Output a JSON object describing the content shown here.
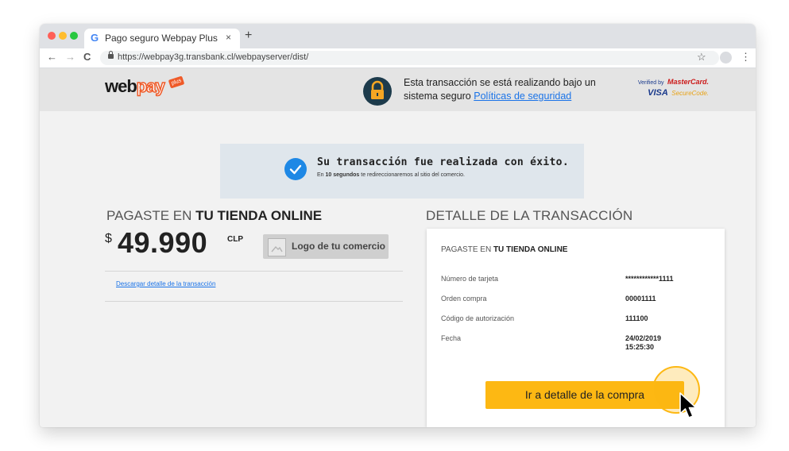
{
  "browser": {
    "tab_favicon": "G",
    "tab_title": "Pago seguro Webpay Plus",
    "tab_close": "×",
    "new_tab": "+",
    "nav_back": "←",
    "nav_forward": "→",
    "nav_reload": "C",
    "url": "https://webpay3g.transbank.cl/webpayserver/dist/",
    "bookmark": "☆",
    "menu": "⋮",
    "traffic_light_colors": [
      "#ff5f57",
      "#ffbd2e",
      "#28c840"
    ]
  },
  "header": {
    "logo_part1": "web",
    "logo_part2": "pay",
    "logo_badge": "plus",
    "notice_text": "Esta transacción se está realizando bajo un sistema seguro",
    "notice_link": "Políticas de seguridad",
    "verified_by": "Verified by",
    "mastercard": "MasterCard.",
    "visa": "VISA",
    "securecode": "SecureCode."
  },
  "success": {
    "title": "Su transacción fue realizada con éxito.",
    "sub_prefix": "En",
    "sub_bold": "10 segundos",
    "sub_rest": "te redireccionaremos al sitio del comercio."
  },
  "payment": {
    "title_prefix": "PAGASTE EN",
    "title_store": "TU TIENDA ONLINE",
    "currency_symbol": "$",
    "amount": "49.990",
    "currency": "CLP",
    "merchant_logo_label": "Logo de tu comercio",
    "download_link": "Descargar detalle de la transacción"
  },
  "detail": {
    "title": "DETALLE DE LA TRANSACCIÓN",
    "card_title_prefix": "PAGASTE EN",
    "card_title_store": "TU TIENDA ONLINE",
    "rows": [
      {
        "label": "Número de tarjeta",
        "value": "************1111"
      },
      {
        "label": "Orden compra",
        "value": "00001111"
      },
      {
        "label": "Código de autorización",
        "value": "111100"
      },
      {
        "label": "Fecha",
        "value": "24/02/2019",
        "value2": "15:25:30"
      }
    ],
    "cta_label": "Ir a detalle de la compra"
  },
  "colors": {
    "accent_yellow": "#fdb813",
    "link_blue": "#1a73e8",
    "success_blue": "#1e88e5",
    "brand_orange": "#ef5a28",
    "lock_navy": "#1d3b4c"
  }
}
